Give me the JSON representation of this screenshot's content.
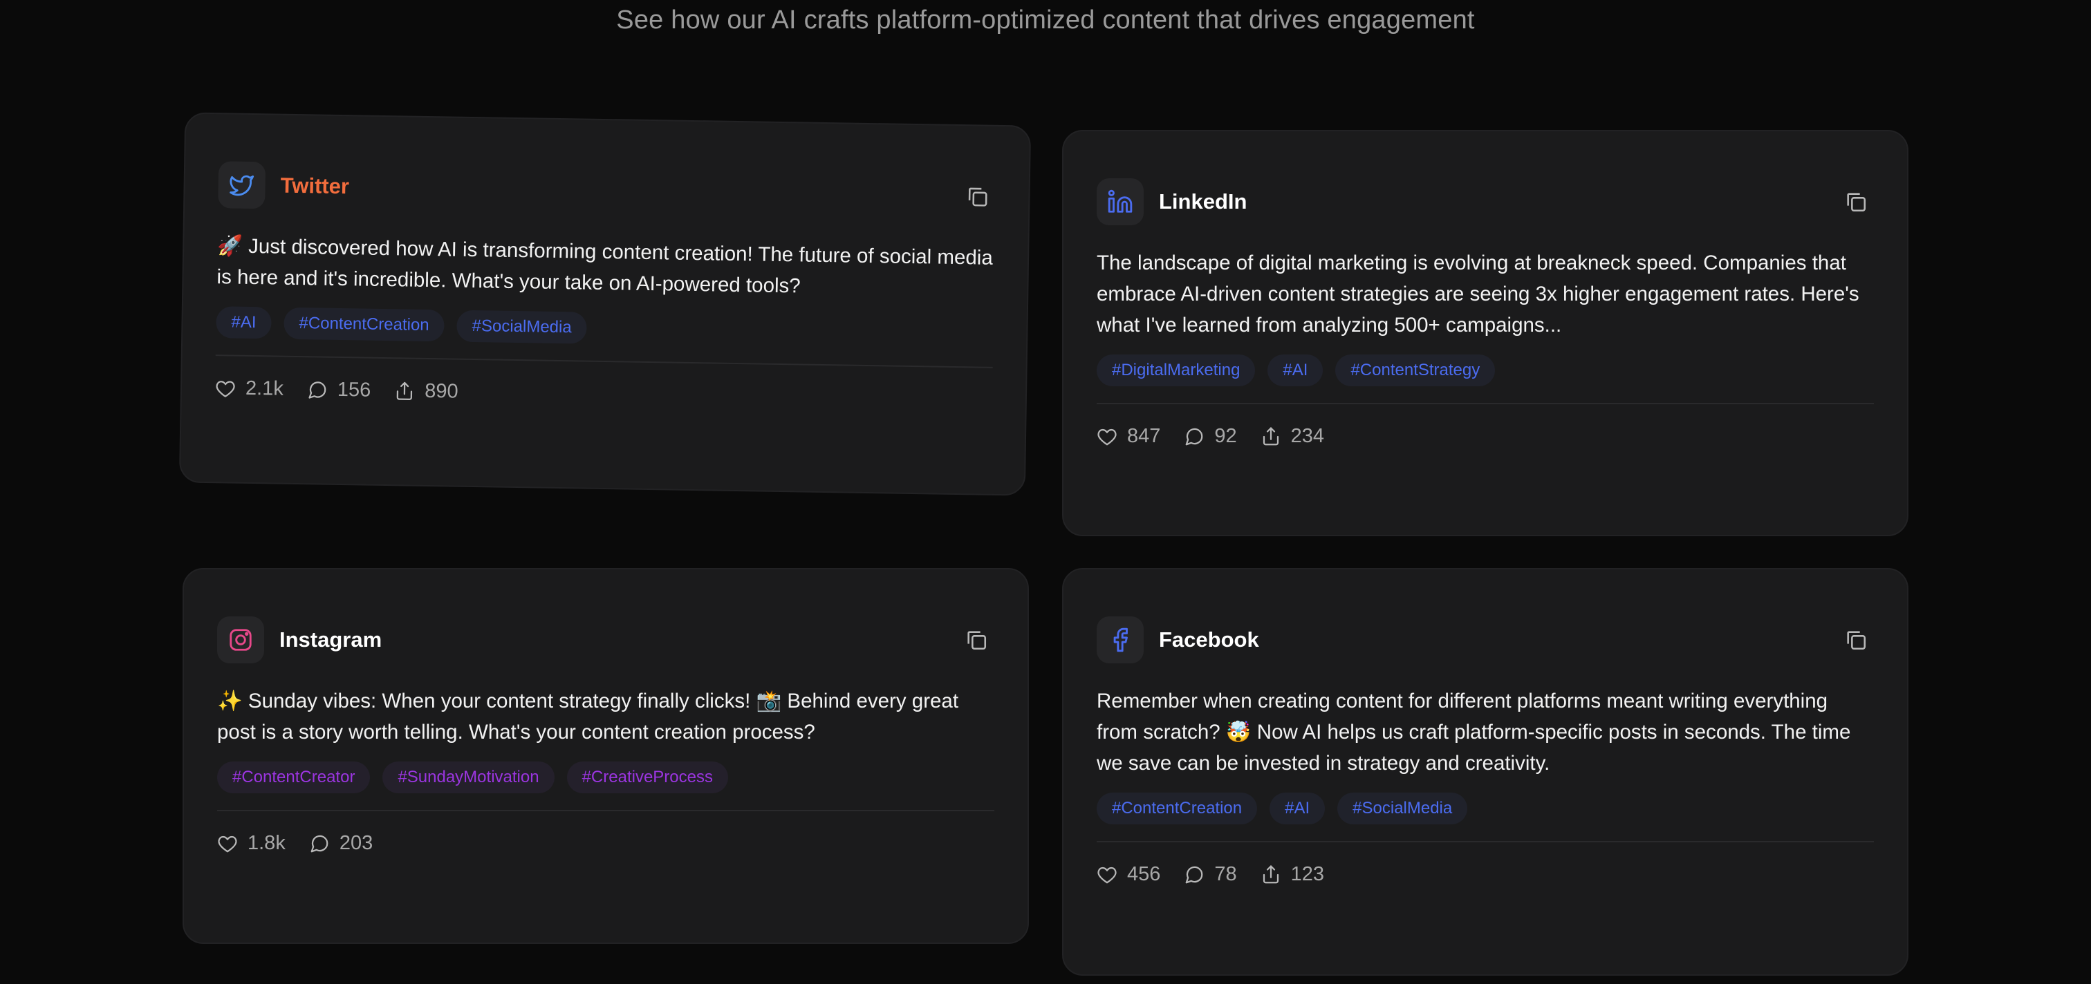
{
  "header": {
    "subtitle": "See how our AI crafts platform-optimized content that drives engagement"
  },
  "colors": {
    "twitter": "#f26d3d",
    "linkedin": "#ffffff",
    "instagram": "#ffffff",
    "facebook": "#ffffff",
    "tag_blue": "#4b6cf0",
    "tag_purple": "#9b35e0"
  },
  "cards": [
    {
      "platform": "Twitter",
      "icon": "twitter-bird-icon",
      "text": "🚀 Just discovered how AI is transforming content creation! The future of social media is here and it's incredible. What's your take on AI-powered tools?",
      "tags": [
        "#AI",
        "#ContentCreation",
        "#SocialMedia"
      ],
      "likes": "2.1k",
      "comments": "156",
      "shares": "890"
    },
    {
      "platform": "LinkedIn",
      "icon": "linkedin-icon",
      "text": "The landscape of digital marketing is evolving at breakneck speed. Companies that embrace AI-driven content strategies are seeing 3x higher engagement rates. Here's what I've learned from analyzing 500+ campaigns...",
      "tags": [
        "#DigitalMarketing",
        "#AI",
        "#ContentStrategy"
      ],
      "likes": "847",
      "comments": "92",
      "shares": "234"
    },
    {
      "platform": "Instagram",
      "icon": "instagram-icon",
      "text": "✨ Sunday vibes: When your content strategy finally clicks! 📸 Behind every great post is a story worth telling. What's your content creation process?",
      "tags": [
        "#ContentCreator",
        "#SundayMotivation",
        "#CreativeProcess"
      ],
      "likes": "1.8k",
      "comments": "203"
    },
    {
      "platform": "Facebook",
      "icon": "facebook-icon",
      "text": "Remember when creating content for different platforms meant writing everything from scratch? 🤯 Now AI helps us craft platform-specific posts in seconds. The time we save can be invested in strategy and creativity.",
      "tags": [
        "#ContentCreation",
        "#AI",
        "#SocialMedia"
      ],
      "likes": "456",
      "comments": "78",
      "shares": "123"
    }
  ]
}
